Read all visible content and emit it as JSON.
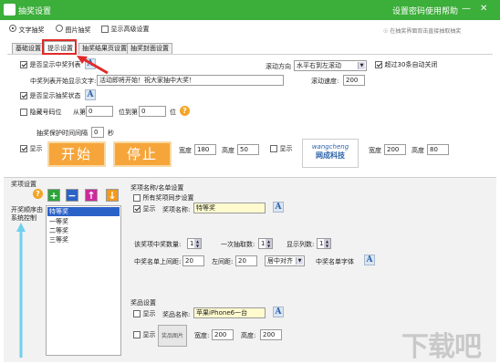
{
  "window": {
    "title": "抽奖设置",
    "settings_link": "设置密码",
    "help_link": "使用帮助",
    "min_glyph": "—",
    "close_glyph": "✕"
  },
  "mode": {
    "text_label": "文字抽奖",
    "image_label": "图片抽奖",
    "advanced_label": "显示高级设置",
    "right_note": "☉ 在抽奖界面双击直接抽取抽奖"
  },
  "tabs": [
    "基础设置",
    "提示设置",
    "抽奖结果页设置",
    "抽奖封面设置"
  ],
  "prompt": {
    "show_winner_list_label": "是否显示中奖列表",
    "direction_label": "滚动方向",
    "direction_value": "水平右到左滚动",
    "auto_close_label": "超过30条自动关闭",
    "start_text_label": "中奖列表开始显示文字:",
    "start_text_value": "活动即将开始！祝大家抽中大奖！",
    "speed_label": "滚动速度:",
    "speed_value": "200",
    "show_status_label": "是否显示抽奖状态",
    "hide_digits_label": "隐藏号码位",
    "from_label": "从第",
    "from_value": "0",
    "to_label": "位到第",
    "to_value": "0",
    "pos_label": "位",
    "interval_label": "抽奖保护时间间隔",
    "interval_value": "0",
    "sec_label": "秒",
    "show_label": "显示",
    "start_btn": "开始",
    "stop_btn": "停止",
    "width_label": "宽度",
    "width_value": "180",
    "height_label": "高度",
    "height_value": "50",
    "show2_label": "显示",
    "logo_text": "wangcheng",
    "logo_cn": "网成科技",
    "width2_label": "宽度",
    "width2_value": "200",
    "height2_label": "高度",
    "height2_value": "80"
  },
  "prize": {
    "section_label": "奖项设置",
    "left_label": "开奖顺序由系统控制",
    "items": [
      "特等奖",
      "一等奖",
      "二等奖",
      "三等奖"
    ],
    "name_section": "奖项名称/名单设置",
    "sync_label": "所有奖项同步设置",
    "show_label": "显示",
    "name_label": "奖项名称:",
    "name_value": "特等奖",
    "count_label": "该奖项中奖数量:",
    "count_value": "1",
    "once_label": "一次抽取数:",
    "once_value": "1",
    "cols_label": "显示列数:",
    "cols_value": "1",
    "top_label": "中奖名单上间距:",
    "top_value": "20",
    "left_margin_label": "左间距:",
    "left_margin_value": "20",
    "align_value": "居中对齐",
    "font_label": "中奖名单字体",
    "item_section": "奖品设置",
    "item_show_label": "显示",
    "item_name_label": "奖品名称:",
    "item_name_value": "苹果iPhone6一台",
    "item_show2_label": "显示",
    "item_img_label": "奖品图片",
    "w_label": "宽度:",
    "w_value": "200",
    "h_label": "高度:",
    "h_value": "200"
  },
  "watermark": "下载吧"
}
